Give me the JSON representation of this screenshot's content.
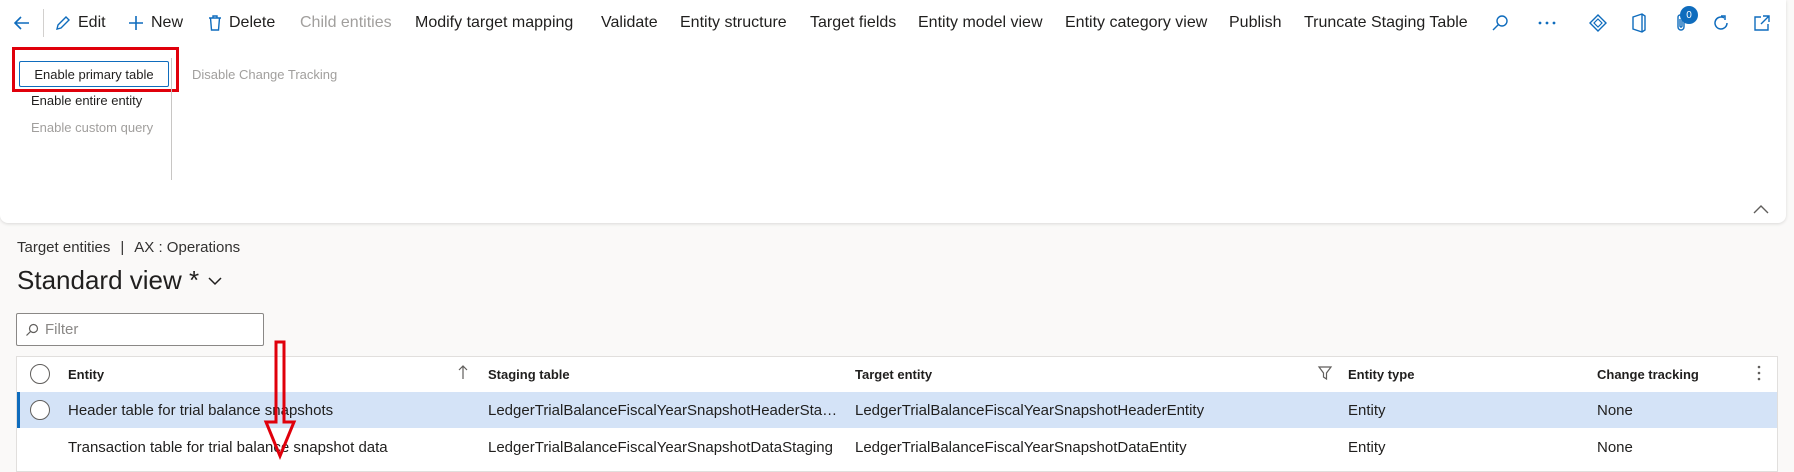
{
  "toolbar": {
    "edit": "Edit",
    "new": "New",
    "delete": "Delete",
    "child_entities": "Child entities",
    "modify_target_mapping": "Modify target mapping",
    "validate": "Validate",
    "entity_structure": "Entity structure",
    "target_fields": "Target fields",
    "entity_model_view": "Entity model view",
    "entity_category_view": "Entity category view",
    "publish": "Publish",
    "truncate_staging_table": "Truncate Staging Table",
    "notification_count": "0"
  },
  "change_tracking_group": {
    "enable_primary_table": "Enable primary table",
    "enable_entire_entity": "Enable entire entity",
    "enable_custom_query": "Enable custom query",
    "disable_change_tracking": "Disable Change Tracking"
  },
  "breadcrumb": {
    "page": "Target entities",
    "separator": "|",
    "company": "AX : Operations"
  },
  "view": {
    "title": "Standard view *"
  },
  "filter": {
    "placeholder": "Filter"
  },
  "grid": {
    "columns": [
      "Entity",
      "Staging table",
      "Target entity",
      "Entity type",
      "Change tracking"
    ],
    "rows": [
      {
        "entity": "Header table for trial balance snapshots",
        "staging_table": "LedgerTrialBalanceFiscalYearSnapshotHeaderStag…",
        "target_entity": "LedgerTrialBalanceFiscalYearSnapshotHeaderEntity",
        "entity_type": "Entity",
        "change_tracking": "None"
      },
      {
        "entity": "Transaction table for trial balance snapshot data",
        "staging_table": "LedgerTrialBalanceFiscalYearSnapshotDataStaging",
        "target_entity": "LedgerTrialBalanceFiscalYearSnapshotDataEntity",
        "entity_type": "Entity",
        "change_tracking": "None"
      }
    ]
  },
  "colors": {
    "accent": "#0f6cbd",
    "selected_row": "#d4e3f7",
    "highlight_red": "#e0000b",
    "disabled_text": "#a19f9d"
  }
}
